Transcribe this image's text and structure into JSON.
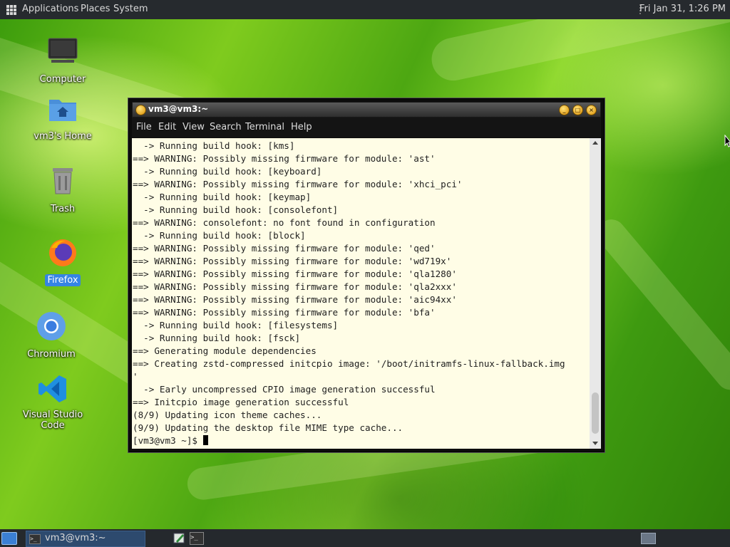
{
  "top_panel": {
    "menus": [
      "Applications",
      "Places",
      "System"
    ],
    "clock": "Fri Jan 31,  1:26 PM"
  },
  "desktop_icons": [
    {
      "label": "Computer",
      "icon": "computer-icon"
    },
    {
      "label": "vm3's Home",
      "icon": "home-folder-icon"
    },
    {
      "label": "Trash",
      "icon": "trash-icon"
    },
    {
      "label": "Firefox",
      "icon": "firefox-icon",
      "selected": true
    },
    {
      "label": "Chromium",
      "icon": "chromium-icon"
    },
    {
      "label": "Visual Studio Code",
      "icon": "vscode-icon"
    }
  ],
  "terminal": {
    "title": "vm3@vm3:~",
    "menus": [
      "File",
      "Edit",
      "View",
      "Search",
      "Terminal",
      "Help"
    ],
    "lines": [
      "  -> Running build hook: [kms]",
      "==> WARNING: Possibly missing firmware for module: 'ast'",
      "  -> Running build hook: [keyboard]",
      "==> WARNING: Possibly missing firmware for module: 'xhci_pci'",
      "  -> Running build hook: [keymap]",
      "  -> Running build hook: [consolefont]",
      "==> WARNING: consolefont: no font found in configuration",
      "  -> Running build hook: [block]",
      "==> WARNING: Possibly missing firmware for module: 'qed'",
      "==> WARNING: Possibly missing firmware for module: 'wd719x'",
      "==> WARNING: Possibly missing firmware for module: 'qla1280'",
      "==> WARNING: Possibly missing firmware for module: 'qla2xxx'",
      "==> WARNING: Possibly missing firmware for module: 'aic94xx'",
      "==> WARNING: Possibly missing firmware for module: 'bfa'",
      "  -> Running build hook: [filesystems]",
      "  -> Running build hook: [fsck]",
      "==> Generating module dependencies",
      "==> Creating zstd-compressed initcpio image: '/boot/initramfs-linux-fallback.img",
      "'",
      "  -> Early uncompressed CPIO image generation successful",
      "==> Initcpio image generation successful",
      "(8/9) Updating icon theme caches...",
      "(9/9) Updating the desktop file MIME type cache..."
    ],
    "prompt": "[vm3@vm3 ~]$ "
  },
  "taskbar": {
    "task_label": "vm3@vm3:~"
  }
}
